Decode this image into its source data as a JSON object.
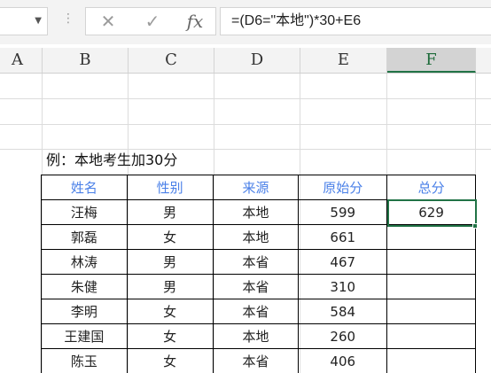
{
  "formula_bar": {
    "namebox_value": "",
    "cancel_symbol": "✕",
    "enter_symbol": "✓",
    "fx_symbol": "fx",
    "formula": "=(D6=\"本地\")*30+E6"
  },
  "columns": [
    "A",
    "B",
    "C",
    "D",
    "E",
    "F"
  ],
  "selected_column": "F",
  "example_title": "例：本地考生加30分",
  "table": {
    "headers": [
      "姓名",
      "性别",
      "来源",
      "原始分",
      "总分"
    ],
    "rows": [
      [
        "汪梅",
        "男",
        "本地",
        "599",
        "629"
      ],
      [
        "郭磊",
        "女",
        "本地",
        "661",
        ""
      ],
      [
        "林涛",
        "男",
        "本省",
        "467",
        ""
      ],
      [
        "朱健",
        "男",
        "本省",
        "310",
        ""
      ],
      [
        "李明",
        "女",
        "本省",
        "584",
        ""
      ],
      [
        "王建国",
        "女",
        "本地",
        "260",
        ""
      ],
      [
        "陈玉",
        "女",
        "本省",
        "406",
        ""
      ]
    ]
  },
  "colors": {
    "header_text": "#4a80e8",
    "selection": "#217346"
  }
}
